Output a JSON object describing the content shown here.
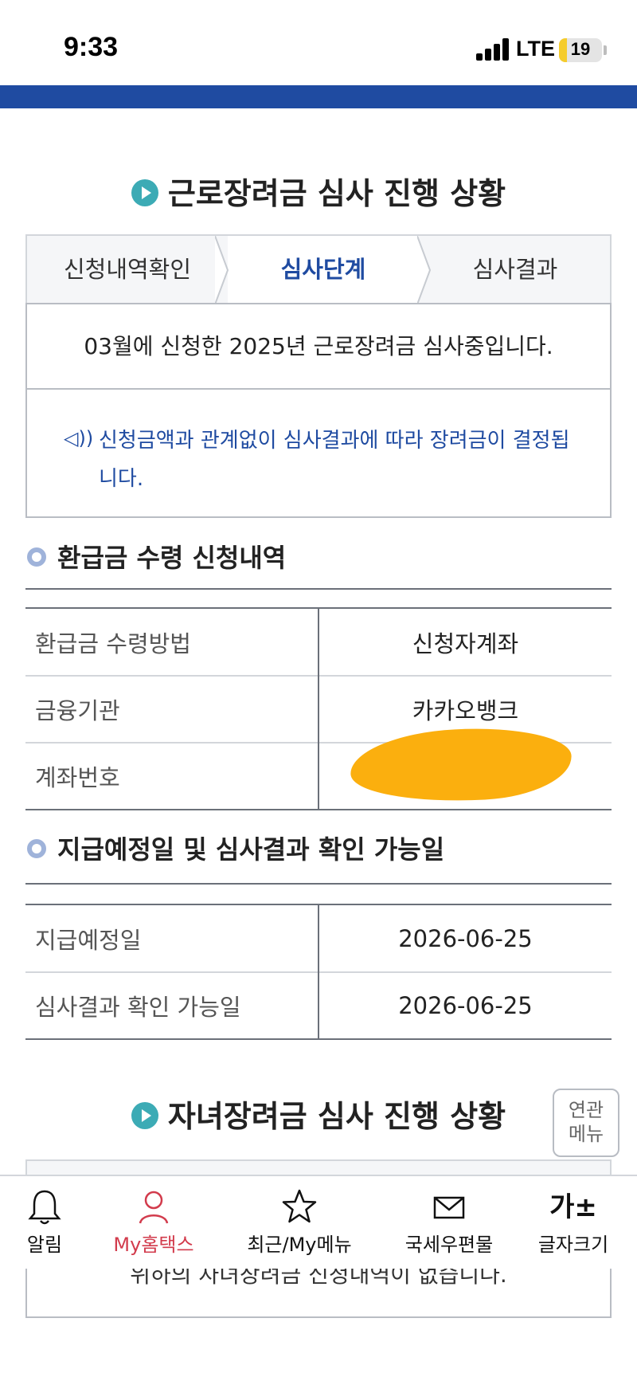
{
  "status_bar": {
    "time": "9:33",
    "network": "LTE",
    "battery": "19",
    "battery_level": 0.19
  },
  "colors": {
    "brand_blue": "#1f4ba1",
    "teal": "#3cabb5",
    "notice_text": "#1f4ba1",
    "active_nav": "#d23b4c",
    "redaction": "#fbaf0e"
  },
  "section1": {
    "title": "근로장려금 심사 진행 상황",
    "tabs": [
      {
        "label": "신청내역확인",
        "active": false
      },
      {
        "label": "심사단계",
        "active": true
      },
      {
        "label": "심사결과",
        "active": false
      }
    ],
    "message": "03월에 신청한 2025년 근로장려금 심사중입니다.",
    "notice_icon": "speaker-icon",
    "notice": "신청금액과 관계없이 심사결과에 따라 장려금이 결정됩니다."
  },
  "refund": {
    "title": "환급금 수령 신청내역",
    "rows": [
      {
        "label": "환급금 수령방법",
        "value": "신청자계좌"
      },
      {
        "label": "금융기관",
        "value": "카카오뱅크"
      },
      {
        "label": "계좌번호",
        "value": ""
      }
    ]
  },
  "schedule": {
    "title": "지급예정일 및 심사결과 확인 가능일",
    "rows": [
      {
        "label": "지급예정일",
        "value": "2026-06-25"
      },
      {
        "label": "심사결과 확인 가능일",
        "value": "2026-06-25"
      }
    ]
  },
  "section2": {
    "title": "자녀장려금 심사 진행 상황",
    "partial_message": "위하의 자녀장려금 신청내역이 없습니다."
  },
  "related_menu": {
    "line1": "연관",
    "line2": "메뉴"
  },
  "bottom_nav": [
    {
      "label": "알림",
      "icon": "bell-icon",
      "active": false
    },
    {
      "label": "My홈택스",
      "icon": "person-icon",
      "active": true
    },
    {
      "label": "최근/My메뉴",
      "icon": "star-icon",
      "active": false
    },
    {
      "label": "국세우편물",
      "icon": "mail-icon",
      "active": false
    },
    {
      "label": "글자크기",
      "icon": "font-size-icon",
      "icon_text": "가±",
      "active": false
    }
  ]
}
